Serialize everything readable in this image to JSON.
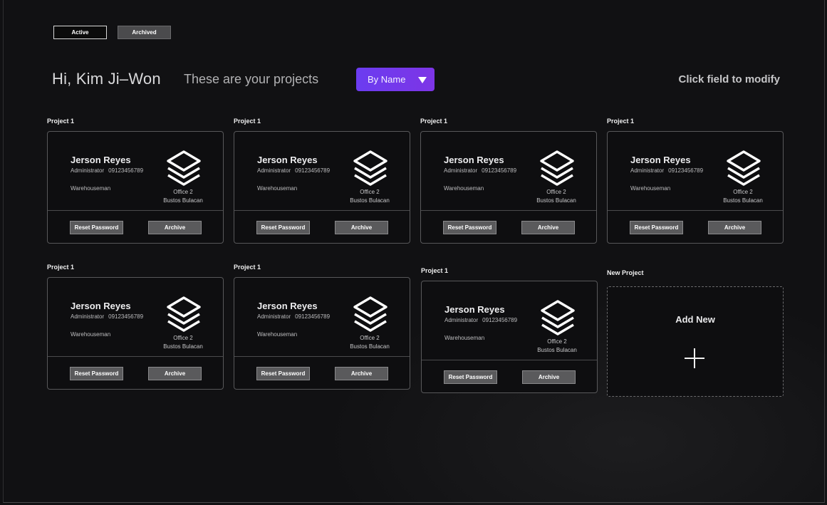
{
  "tabs": {
    "active": "Active",
    "archived": "Archived"
  },
  "header": {
    "greeting": "Hi, Kim Ji–Won",
    "subtitle": "These are your projects",
    "sort_label": "By Name",
    "hint": "Click field to modify"
  },
  "projects": [
    {
      "title": "Project 1",
      "name": "Jerson Reyes",
      "role": "Administrator",
      "phone": "09123456789",
      "job": "Warehouseman",
      "office": "Office 2",
      "location": "Bustos Bulacan",
      "reset_label": "Reset Password",
      "archive_label": "Archive"
    },
    {
      "title": "Project 1",
      "name": "Jerson Reyes",
      "role": "Administrator",
      "phone": "09123456789",
      "job": "Warehouseman",
      "office": "Office 2",
      "location": "Bustos Bulacan",
      "reset_label": "Reset Password",
      "archive_label": "Archive"
    },
    {
      "title": "Project 1",
      "name": "Jerson Reyes",
      "role": "Administrator",
      "phone": "09123456789",
      "job": "Warehouseman",
      "office": "Office 2",
      "location": "Bustos Bulacan",
      "reset_label": "Reset Password",
      "archive_label": "Archive"
    },
    {
      "title": "Project 1",
      "name": "Jerson Reyes",
      "role": "Administrator",
      "phone": "09123456789",
      "job": "Warehouseman",
      "office": "Office 2",
      "location": "Bustos Bulacan",
      "reset_label": "Reset Password",
      "archive_label": "Archive"
    },
    {
      "title": "Project 1",
      "name": "Jerson Reyes",
      "role": "Administrator",
      "phone": "09123456789",
      "job": "Warehouseman",
      "office": "Office 2",
      "location": "Bustos Bulacan",
      "reset_label": "Reset Password",
      "archive_label": "Archive"
    },
    {
      "title": "Project 1",
      "name": "Jerson Reyes",
      "role": "Administrator",
      "phone": "09123456789",
      "job": "Warehouseman",
      "office": "Office 2",
      "location": "Bustos Bulacan",
      "reset_label": "Reset Password",
      "archive_label": "Archive"
    },
    {
      "title": "Project 1",
      "name": "Jerson Reyes",
      "role": "Administrator",
      "phone": "09123456789",
      "job": "Warehouseman",
      "office": "Office 2",
      "location": "Bustos Bulacan",
      "reset_label": "Reset Password",
      "archive_label": "Archive"
    }
  ],
  "new_project": {
    "title": "New Project",
    "add_label": "Add New"
  },
  "icons": {
    "project": "stack-layers-icon",
    "add": "plus-icon",
    "sort": "caret-down-icon"
  },
  "colors": {
    "accent": "#7b3aeb",
    "background": "#111113",
    "card": "#0e0e10",
    "button": "#5a5a5c"
  }
}
